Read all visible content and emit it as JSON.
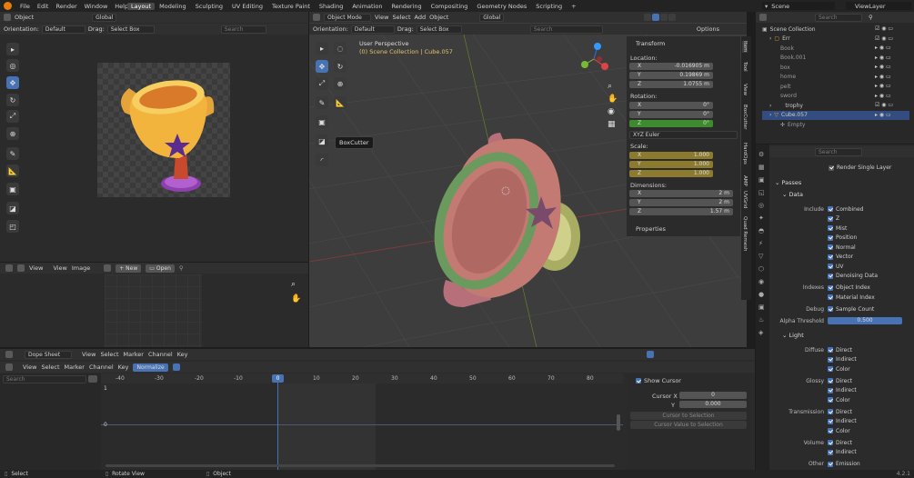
{
  "topbar": {
    "menus": [
      "File",
      "Edit",
      "Render",
      "Window",
      "Help"
    ],
    "workspaces": [
      "Layout",
      "Modeling",
      "Sculpting",
      "UV Editing",
      "Texture Paint",
      "Shading",
      "Animation",
      "Rendering",
      "Compositing",
      "Geometry Nodes",
      "Scripting"
    ],
    "active_workspace": "Layout",
    "scene_label": "Scene",
    "viewlayer_label": "ViewLayer"
  },
  "image_editor": {
    "object_menu": "Object",
    "orientation_label": "Orientation:",
    "orientation_value": "Default",
    "drag_label": "Drag:",
    "drag_value": "Select Box",
    "global_value": "Global",
    "search_placeholder": "Search"
  },
  "uv_editor": {
    "view": "View",
    "view2": "View",
    "image": "Image",
    "new_btn": "New",
    "open_btn": "Open"
  },
  "viewport": {
    "mode": "Object Mode",
    "menus": [
      "View",
      "Select",
      "Add",
      "Object"
    ],
    "global_value": "Global",
    "orientation_label": "Orientation:",
    "orientation_value": "Default",
    "drag_label": "Drag:",
    "drag_value": "Select Box",
    "options": "Options",
    "perspective": "User Perspective",
    "collection_path": "(0) Scene Collection | Cube.057",
    "tooltip": "BoxCutter",
    "search_placeholder": "Search"
  },
  "transform_panel": {
    "title": "Transform",
    "location_label": "Location:",
    "location": {
      "x": "-0.016905 m",
      "y": "0.19869 m",
      "z": "1.0755 m"
    },
    "rotation_label": "Rotation:",
    "rotation": {
      "x": "0°",
      "y": "0°",
      "z": "0°"
    },
    "rotation_mode": "XYZ Euler",
    "scale_label": "Scale:",
    "scale": {
      "x": "1.000",
      "y": "1.000",
      "z": "1.000"
    },
    "dimensions_label": "Dimensions:",
    "dimensions": {
      "x": "2 m",
      "y": "2 m",
      "z": "1.57 m"
    },
    "properties": "Properties",
    "axis_labels": [
      "X",
      "Y",
      "Z"
    ]
  },
  "side_tabs": [
    "Item",
    "Tool",
    "View",
    "BoxCutter",
    "HardOps",
    "AMP",
    "UVGrid",
    "Quad Remesh"
  ],
  "outliner": {
    "search_placeholder": "Search",
    "root": "Scene Collection",
    "items": [
      "Err",
      "Book",
      "Book.001",
      "box",
      "home",
      "pelt",
      "sword",
      "trophy",
      "Cube.057",
      "Empty"
    ]
  },
  "properties_panel": {
    "search_placeholder": "Search",
    "render_single_layer": "Render Single Layer",
    "passes": "Passes",
    "data": "Data",
    "include_label": "Include",
    "include": [
      "Combined",
      "Z",
      "Mist",
      "Position",
      "Normal",
      "Vector",
      "UV",
      "Denoising Data"
    ],
    "indexes_label": "Indexes",
    "indexes": [
      "Object Index",
      "Material Index"
    ],
    "debug_label": "Debug",
    "debug": "Sample Count",
    "alpha_threshold_label": "Alpha Threshold",
    "alpha_threshold": "0.500",
    "light": "Light",
    "diffuse_label": "Diffuse",
    "diffuse": [
      "Direct",
      "Indirect",
      "Color"
    ],
    "glossy_label": "Glossy",
    "glossy": [
      "Direct",
      "Indirect",
      "Color"
    ],
    "transmission_label": "Transmission",
    "transmission": [
      "Direct",
      "Indirect",
      "Color"
    ],
    "volume_label": "Volume",
    "volume": [
      "Direct",
      "Indirect"
    ],
    "other_label": "Other",
    "other": "Emission"
  },
  "dopesheet": {
    "mode": "Dope Sheet",
    "menus1": [
      "View",
      "Select",
      "Marker",
      "Channel",
      "Key"
    ],
    "menus2": [
      "View",
      "Select",
      "Marker",
      "Channel",
      "Key"
    ],
    "normalize": "Normalize",
    "search_placeholder": "Search",
    "ticks": [
      "-40",
      "-30",
      "-20",
      "-10",
      "0",
      "10",
      "20",
      "30",
      "40",
      "50",
      "60",
      "70",
      "80"
    ],
    "current_frame": "0",
    "y_ticks": [
      "1",
      "0"
    ]
  },
  "cursor_panel": {
    "show_cursor": "Show Cursor",
    "cursor_x_label": "Cursor X",
    "cursor_x": "0",
    "y_label": "Y",
    "y_value": "0.000",
    "cursor_to_selection": "Cursor to Selection",
    "cursor_value_to_selection": "Cursor Value to Selection"
  },
  "statusbar": {
    "select": "Select",
    "rotate_view": "Rotate View",
    "object": "Object",
    "version": "4.2.1"
  },
  "colors": {
    "accent": "#4772b3",
    "active_tab": "#4a4a4a",
    "scale_field": "#8c7a2e",
    "rot_z_field": "#3e8a2e"
  }
}
